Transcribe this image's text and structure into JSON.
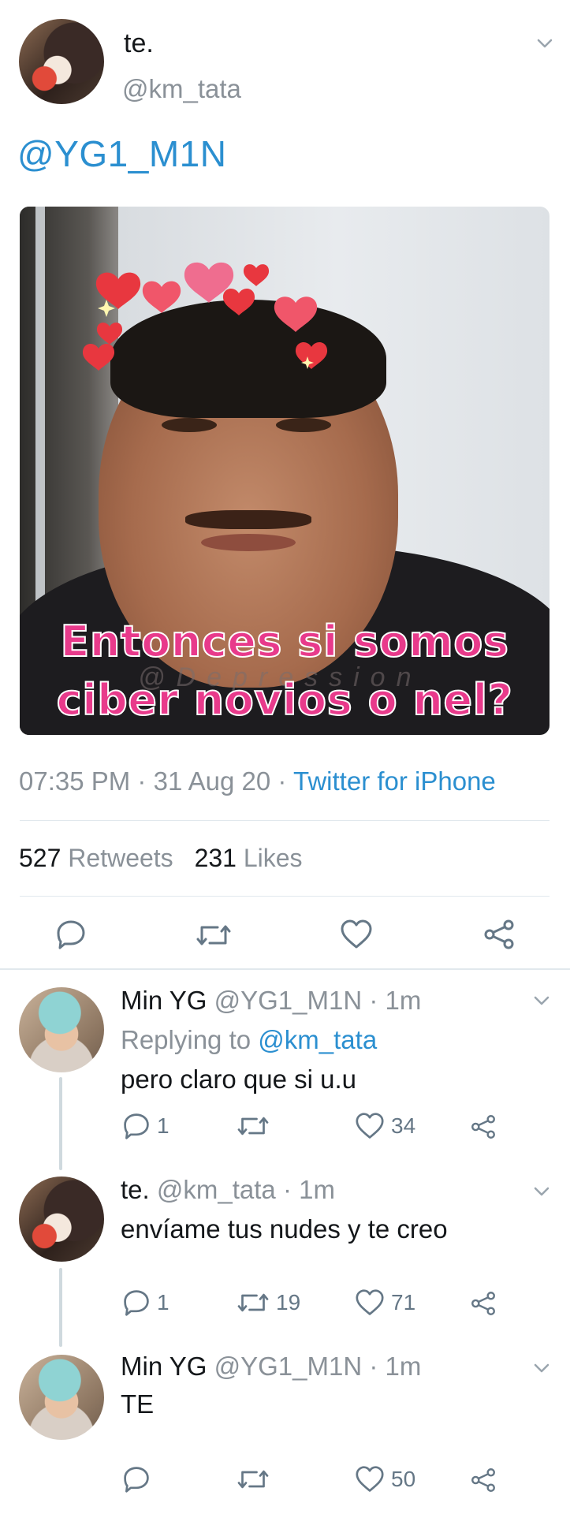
{
  "tweet": {
    "author_name": "te.",
    "author_handle": "@km_tata",
    "text": "@YG1_M1N",
    "image_caption_line1": "Entonces  si somos",
    "image_caption_line2": "ciber novios o nel?",
    "image_watermark": "@Depression",
    "time": "07:35 PM",
    "date": "31 Aug 20",
    "source": "Twitter for iPhone",
    "retweets_count": "527",
    "retweets_label": "Retweets",
    "likes_count": "231",
    "likes_label": "Likes"
  },
  "replies": [
    {
      "name": "Min YG",
      "handle": "@YG1_M1N",
      "time": "1m",
      "replying_label": "Replying to",
      "replying_handle": "@km_tata",
      "text": "pero claro que si u.u",
      "replies": "1",
      "retweets": "",
      "likes": "34"
    },
    {
      "name": "te.",
      "handle": "@km_tata",
      "time": "1m",
      "text": "envíame tus nudes y te creo",
      "replies": "1",
      "retweets": "19",
      "likes": "71"
    },
    {
      "name": "Min YG",
      "handle": "@YG1_M1N",
      "time": "1m",
      "text": "TE",
      "replies": "",
      "retweets": "",
      "likes": "50"
    }
  ],
  "separator": "·",
  "colors": {
    "link": "#2b8fd0",
    "muted": "#8a9198",
    "divider": "#e1e8ed"
  }
}
